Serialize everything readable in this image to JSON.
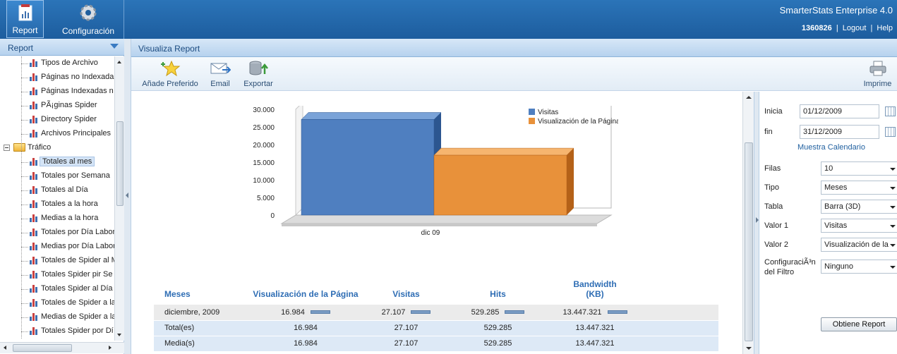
{
  "app": {
    "brand": "SmarterStats Enterprise 4.0",
    "user_id": "1360826",
    "logout": "Logout",
    "help": "Help",
    "link_sep": "|"
  },
  "topnav": {
    "report": "Report",
    "config": "Configuración"
  },
  "sidebar": {
    "title": "Report",
    "items": [
      {
        "label": "Tipos de Archivo",
        "kind": "report",
        "level": 2
      },
      {
        "label": "Páginas no Indexada",
        "kind": "report",
        "level": 2
      },
      {
        "label": "Páginas Indexadas n",
        "kind": "report",
        "level": 2
      },
      {
        "label": "PÃ¡ginas Spider",
        "kind": "report",
        "level": 2
      },
      {
        "label": "Directory Spider",
        "kind": "report",
        "level": 2
      },
      {
        "label": "Archivos Principales",
        "kind": "report",
        "level": 2
      },
      {
        "label": "Tráfico",
        "kind": "folder",
        "level": 1
      },
      {
        "label": "Totales al mes",
        "kind": "report",
        "level": 2,
        "selected": true
      },
      {
        "label": "Totales por Semana",
        "kind": "report",
        "level": 2
      },
      {
        "label": "Totales al Día",
        "kind": "report",
        "level": 2
      },
      {
        "label": "Totales a la hora",
        "kind": "report",
        "level": 2
      },
      {
        "label": "Medias a la hora",
        "kind": "report",
        "level": 2
      },
      {
        "label": "Totales por Día Labor",
        "kind": "report",
        "level": 2
      },
      {
        "label": "Medias por Día Labor",
        "kind": "report",
        "level": 2
      },
      {
        "label": "Totales de Spider al M",
        "kind": "report",
        "level": 2
      },
      {
        "label": "Totales Spider pir Se",
        "kind": "report",
        "level": 2
      },
      {
        "label": "Totales Spider al Día",
        "kind": "report",
        "level": 2
      },
      {
        "label": "Totales de Spider a la",
        "kind": "report",
        "level": 2
      },
      {
        "label": "Medias de Spider a la",
        "kind": "report",
        "level": 2
      },
      {
        "label": "Totales Spider por Dí",
        "kind": "report",
        "level": 2
      }
    ]
  },
  "main": {
    "title": "Visualiza Report",
    "toolbar": {
      "fav": "Añade Preferido",
      "email": "Email",
      "export": "Exportar",
      "print": "Imprime"
    }
  },
  "filters": {
    "start_label": "Inicia",
    "start_value": "01/12/2009",
    "end_label": "fin",
    "end_value": "31/12/2009",
    "calendar_link": "Muestra Calendario",
    "rows_label": "Filas",
    "rows_value": "10",
    "type_label": "Tipo",
    "type_value": "Meses",
    "chart_label": "Tabla",
    "chart_value": "Barra (3D)",
    "v1_label": "Valor 1",
    "v1_value": "Visitas",
    "v2_label": "Valor 2",
    "v2_value": "Visualización de la",
    "filter_label_1": "ConfiguraciÃ³n",
    "filter_label_2": "del Filtro",
    "filter_value": "Ninguno",
    "submit": "Obtiene Report"
  },
  "chart_data": {
    "type": "bar",
    "categories": [
      "dic 09"
    ],
    "series": [
      {
        "name": "Visitas",
        "values": [
          27107
        ],
        "color": "#4f7fc0"
      },
      {
        "name": "Visualización de la Página",
        "values": [
          16984
        ],
        "color": "#e8913a"
      }
    ],
    "yticks": [
      "30.000",
      "25.000",
      "20.000",
      "15.000",
      "10.000",
      "5.000",
      "0"
    ],
    "ylim": [
      0,
      30000
    ]
  },
  "table": {
    "headers": [
      "Meses",
      "Visualización de la Página",
      "Visitas",
      "Hits",
      "Bandwidth",
      "(KB)"
    ],
    "rows": [
      [
        "diciembre, 2009",
        "16.984",
        "27.107",
        "529.285",
        "13.447.321"
      ],
      [
        "Total(es)",
        "16.984",
        "27.107",
        "529.285",
        "13.447.321"
      ],
      [
        "Media(s)",
        "16.984",
        "27.107",
        "529.285",
        "13.447.321"
      ]
    ]
  }
}
